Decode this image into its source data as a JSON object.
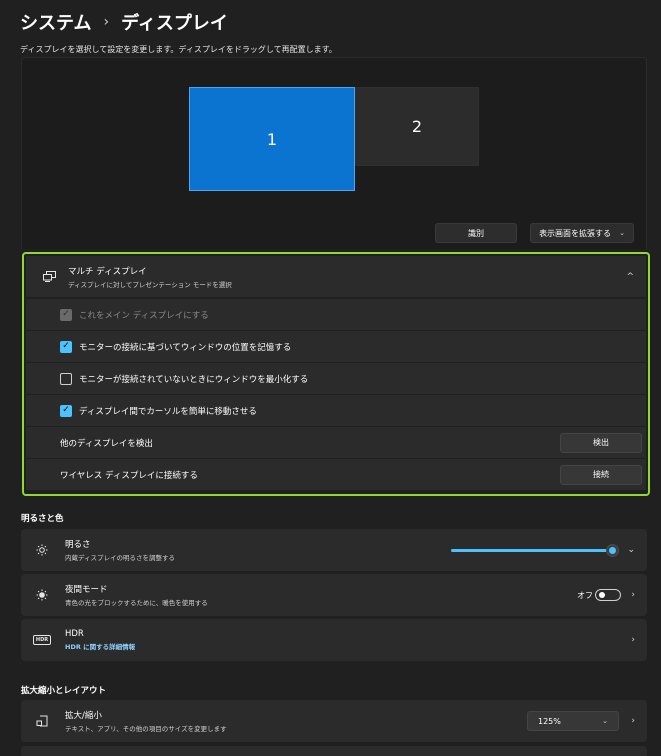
{
  "breadcrumb": {
    "parent": "システム",
    "separator": "›",
    "current": "ディスプレイ"
  },
  "subtitle": "ディスプレイを選択して設定を変更します。ディスプレイをドラッグして再配置します。",
  "monitors": [
    {
      "label": "1"
    },
    {
      "label": "2"
    }
  ],
  "arrangement": {
    "identify_label": "識別",
    "extend_label": "表示画面を拡張する",
    "extend_chevron": "⌄"
  },
  "multi_display": {
    "title": "マルチ ディスプレイ",
    "subtitle": "ディスプレイに対してプレゼンテーション モードを選択",
    "collapse_chevron": "^",
    "options": [
      {
        "label": "これをメイン ディスプレイにする",
        "checked": true,
        "disabled": true
      },
      {
        "label": "モニターの接続に基づいてウィンドウの位置を記憶する",
        "checked": true,
        "disabled": false
      },
      {
        "label": "モニターが接続されていないときにウィンドウを最小化する",
        "checked": false,
        "disabled": false
      },
      {
        "label": "ディスプレイ間でカーソルを簡単に移動させる",
        "checked": true,
        "disabled": false
      }
    ],
    "detect": {
      "label": "他のディスプレイを検出",
      "button": "検出"
    },
    "wireless": {
      "label": "ワイヤレス ディスプレイに接続する",
      "button": "接続"
    }
  },
  "brightness_section": {
    "heading": "明るさと色",
    "brightness": {
      "title": "明るさ",
      "subtitle": "内蔵ディスプレイの明るさを調整する",
      "value_percent": 100,
      "chevron": "⌄"
    },
    "night_light": {
      "title": "夜間モード",
      "subtitle": "青色の光をブロックするために、暖色を使用する",
      "toggle_label": "オフ",
      "chevron": "›"
    },
    "hdr": {
      "title": "HDR",
      "link": "HDR に関する詳細情報",
      "icon_text": "HDR",
      "chevron": "›"
    }
  },
  "scale_section": {
    "heading": "拡大縮小とレイアウト",
    "scale": {
      "title": "拡大/縮小",
      "subtitle": "テキスト、アプリ、その他の項目のサイズを変更します",
      "value": "125%",
      "select_chevron": "⌄",
      "chevron": "›"
    }
  },
  "colors": {
    "accent": "#4cc2ff",
    "highlight_border": "#8fd838",
    "monitor_selected": "#0b74d0"
  }
}
